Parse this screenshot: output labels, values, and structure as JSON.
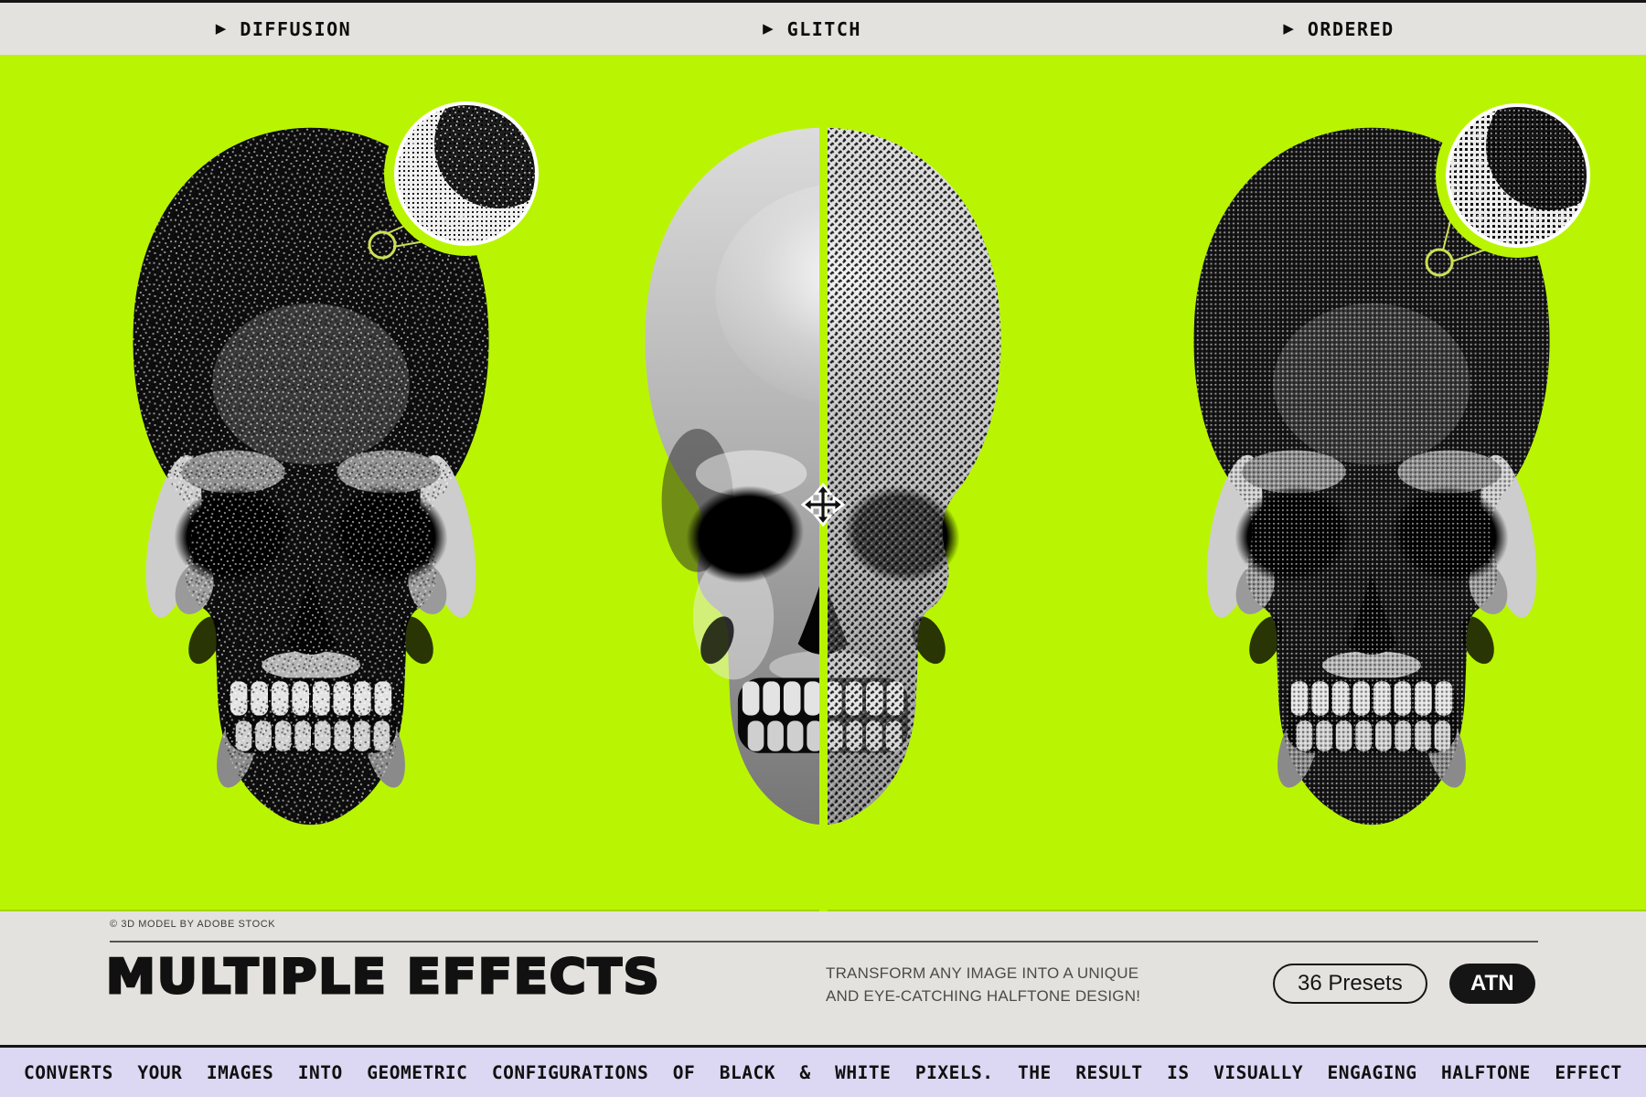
{
  "theme": {
    "background_green": "#b9f502",
    "bar_gray": "#e3e2de",
    "marquee_lavender": "#dcd7f2",
    "ink_black": "#111111",
    "callout_line_green": "#cde054",
    "button_text_white": "#ffffff"
  },
  "top_bar": {
    "arrow_glyph": "▶",
    "items": [
      {
        "label": "DIFFUSION"
      },
      {
        "label": "GLITCH"
      },
      {
        "label": "ORDERED"
      }
    ]
  },
  "canvas": {
    "panels": [
      {
        "effect": "diffusion",
        "graphic": "dithered-skull-with-detail-magnifier"
      },
      {
        "effect": "glitch",
        "graphic": "before-after-split-skull-with-move-cursor"
      },
      {
        "effect": "ordered",
        "graphic": "dithered-skull-with-detail-magnifier"
      }
    ]
  },
  "footer": {
    "credit": "© 3D MODEL BY ADOBE STOCK",
    "title": "MULTIPLE EFFECTS",
    "tagline_line1": "TRANSFORM ANY IMAGE INTO A UNIQUE",
    "tagline_line2": "AND EYE-CATCHING HALFTONE DESIGN!",
    "presets_button_label": "36 Presets",
    "atn_button_label": "ATN"
  },
  "marquee": {
    "words": [
      "CONVERTS",
      "YOUR",
      "IMAGES",
      "INTO",
      "GEOMETRIC",
      "CONFIGURATIONS",
      "OF",
      "BLACK",
      "&",
      "WHITE",
      "PIXELS.",
      "THE",
      "RESULT",
      "IS",
      "VISUALLY",
      "ENGAGING",
      "HALFTONE",
      "EFFECT"
    ]
  }
}
